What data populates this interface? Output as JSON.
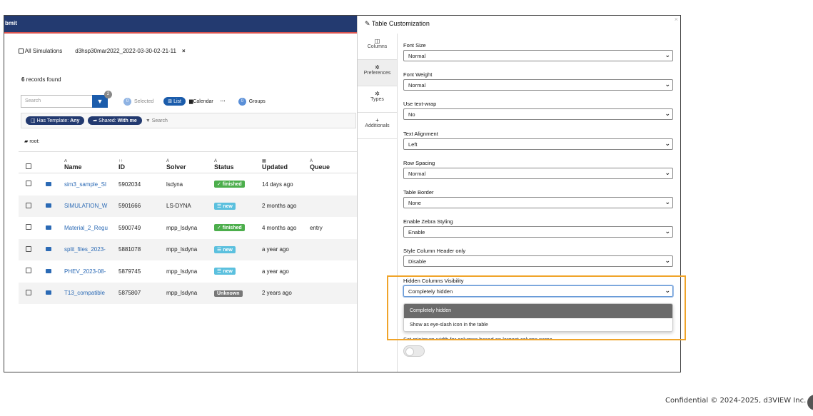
{
  "topbar": {
    "title": "bmit"
  },
  "tabs": {
    "all_label": "All Simulations",
    "active_label": "d3hsp30mar2022_2022-03-30-02-21-11",
    "close": "×"
  },
  "records": {
    "count": "6",
    "suffix": " records found"
  },
  "toolbar": {
    "search_placeholder": "Search",
    "filter_badge": "2",
    "selected_count": "0",
    "selected_label": "Selected",
    "list_label": "List",
    "calendar_label": "Calendar",
    "more_label": "···",
    "groups_count": "0",
    "groups_label": "Groups"
  },
  "chips": {
    "template_prefix": "Has Template: ",
    "template_value": "Any",
    "shared_prefix": "Shared: ",
    "shared_value": "With me",
    "search_label": "Search"
  },
  "root": {
    "label": "root:"
  },
  "table": {
    "headers": {
      "name": "Name",
      "id": "ID",
      "solver": "Solver",
      "status": "Status",
      "updated": "Updated",
      "queue": "Queue",
      "name_arrow": "A",
      "id_arrow": "↑↑",
      "solver_arrow": "A",
      "status_arrow": "A",
      "updated_arrow": "▦",
      "queue_arrow": "A"
    },
    "rows": [
      {
        "name": "sim3_sample_SI",
        "id": "5902034",
        "solver": "lsdyna",
        "status": "✓ finished",
        "updated": "14 days ago",
        "queue": ""
      },
      {
        "name": "SIMULATION_W",
        "id": "5901666",
        "solver": "LS-DYNA",
        "status": "☰ new",
        "updated": "2 months ago",
        "queue": ""
      },
      {
        "name": "Material_2_Regu",
        "id": "5900749",
        "solver": "mpp_lsdyna",
        "status": "✓ finished",
        "updated": "4 months ago",
        "queue": "entry"
      },
      {
        "name": "split_files_2023-",
        "id": "5881078",
        "solver": "mpp_lsdyna",
        "status": "☰ new",
        "updated": "a year ago",
        "queue": ""
      },
      {
        "name": "PHEV_2023-08-",
        "id": "5879745",
        "solver": "mpp_lsdyna",
        "status": "☰ new",
        "updated": "a year ago",
        "queue": ""
      },
      {
        "name": "T13_compatible",
        "id": "5875807",
        "solver": "mpp_lsdyna",
        "status": "Unknown",
        "updated": "2 years ago",
        "queue": ""
      }
    ]
  },
  "colors": {
    "finished": "#4cae4c",
    "new": "#5bc0de",
    "unknown": "#777777",
    "highlight": "#f0a42a",
    "topbar": "#233a70"
  },
  "panel": {
    "title": "Table Customization",
    "close": "×",
    "sidebar": [
      {
        "icon": "◫",
        "label": "Columns"
      },
      {
        "icon": "✲",
        "label": "Preferences"
      },
      {
        "icon": "✲",
        "label": "Types"
      },
      {
        "icon": "+",
        "label": "Additionals"
      }
    ],
    "options": [
      {
        "label": "Font Size",
        "value": "Normal"
      },
      {
        "label": "Font Weight",
        "value": "Normal"
      },
      {
        "label": "Use text-wrap",
        "value": "No"
      },
      {
        "label": "Text Alignment",
        "value": "Left"
      },
      {
        "label": "Row Spacing",
        "value": "Normal"
      },
      {
        "label": "Table Border",
        "value": "None"
      },
      {
        "label": "Enable Zebra Styling",
        "value": "Enable"
      },
      {
        "label": "Style Column Header only",
        "value": "Disable"
      },
      {
        "label": "Hidden Columns Visibility",
        "value": "Completely hidden"
      }
    ],
    "dropdown_options": [
      "Completely hidden",
      "Show as eye-slash icon in the table"
    ],
    "min_width_label": "Set minimum width for columns based on largest column name"
  },
  "footer": {
    "text": "Confidential © 2024-2025, d3VIEW Inc."
  }
}
